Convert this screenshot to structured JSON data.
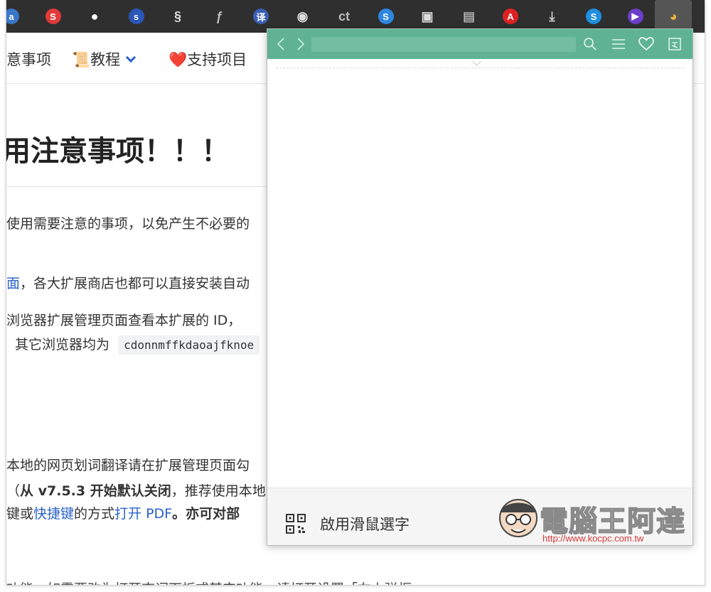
{
  "extensions": [
    {
      "name": "bookmark-ext-icon",
      "glyph": "a",
      "color": "#3b77c9"
    },
    {
      "name": "s-red-ext-icon",
      "glyph": "S",
      "color": "#e23a3a"
    },
    {
      "name": "record-ext-icon",
      "glyph": "●",
      "color": "#ffffff"
    },
    {
      "name": "s-blue-ext-icon",
      "glyph": "s",
      "color": "#2b56b8"
    },
    {
      "name": "swirl-ext-icon",
      "glyph": "§",
      "color": "#dddddd"
    },
    {
      "name": "feather-ext-icon",
      "glyph": "ƒ",
      "color": "#bbbbbb"
    },
    {
      "name": "translate-ext-icon",
      "glyph": "译",
      "color": "#3a5fb2"
    },
    {
      "name": "lock-ext-icon",
      "glyph": "◉",
      "color": "#dddddd"
    },
    {
      "name": "ct-ext-icon",
      "glyph": "ct",
      "color": "#bbbbbb"
    },
    {
      "name": "s-square-ext-icon",
      "glyph": "S",
      "color": "#2f86e0"
    },
    {
      "name": "image-ext-icon",
      "glyph": "▣",
      "color": "#dddddd"
    },
    {
      "name": "gallery-ext-icon",
      "glyph": "▤",
      "color": "#aaaaaa"
    },
    {
      "name": "pdf-ext-icon",
      "glyph": "A",
      "color": "#d22"
    },
    {
      "name": "download-ext-icon",
      "glyph": "⤓",
      "color": "#cccccc"
    },
    {
      "name": "shazam-ext-icon",
      "glyph": "S",
      "color": "#1f8fe0"
    },
    {
      "name": "play-ext-icon",
      "glyph": "▶",
      "color": "#6b3fc9"
    },
    {
      "name": "saladict-ext-icon",
      "glyph": "◕",
      "color": "#f0b33a"
    }
  ],
  "nav": {
    "notes": "意事项",
    "tutorial": "📜教程",
    "support": "❤️支持项目"
  },
  "article": {
    "heading": "用注意事项！！！",
    "p1": "使用需要注意的事项，以免产生不必要的",
    "p2_link": "面",
    "p2_rest": "，各大扩展商店也都可以直接安装自动",
    "p3": "浏览器扩展管理页面查看本扩展的 ID，",
    "p4_prefix": "其它浏览器均为",
    "p4_code": "cdonnmffkdaoajfknoe",
    "p5": "本地的网页划词翻译请在扩展管理页面勾",
    "p6_a": "（",
    "p6_bold": "从 v7.5.3 开始默认关闭",
    "p6_rest": "，推荐使用本地",
    "p7_a": "键或",
    "p7_link1": "快捷键",
    "p7_b": "的方式",
    "p7_link2": "打开 PDF",
    "p7_bold": "。亦可对部",
    "p8": "功能，如需要改为打开查词面板或其它功能，请打开设置「右上弹框"
  },
  "popup": {
    "search": {
      "value": "",
      "placeholder": ""
    },
    "footer_label": "啟用滑鼠選字"
  },
  "watermark": {
    "title": "電腦王阿達",
    "url": "http://www.kocpc.com.tw"
  }
}
